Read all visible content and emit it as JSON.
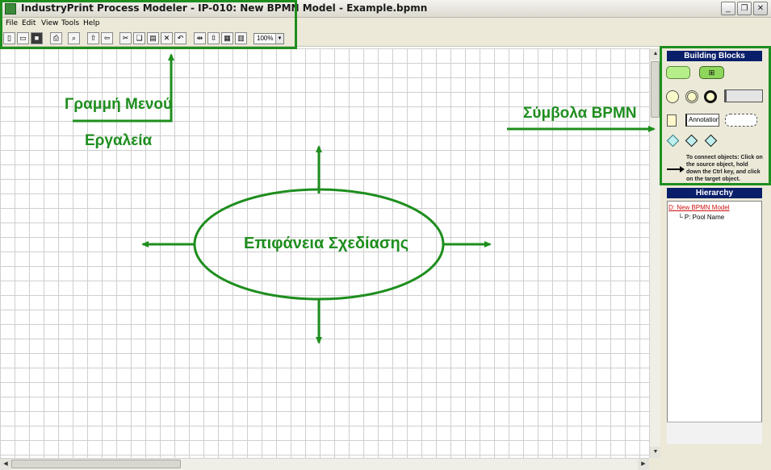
{
  "window": {
    "title": "IndustryPrint Process Modeler - IP-010: New BPMN Model - Example.bpmn",
    "controls": [
      "minimize-icon",
      "restore-icon",
      "close-icon"
    ]
  },
  "menu": [
    "File",
    "Edit",
    "View",
    "Tools",
    "Help"
  ],
  "toolbar": {
    "buttons": [
      "new-icon",
      "open-icon",
      "save-icon",
      "print-icon",
      "find-icon",
      "up-icon",
      "back-icon",
      "cut-icon",
      "copy-icon",
      "paste-icon",
      "delete-icon",
      "undo-icon",
      "align-h-icon",
      "align-v-icon",
      "distribute-icon",
      "layout-icon"
    ],
    "zoom": "100%"
  },
  "panels": {
    "building_blocks": {
      "title": "Building Blocks",
      "annotation_label": "Annotation",
      "help": "To connect objects: Click on the source object, hold down the Ctrl key, and click on the target object."
    },
    "hierarchy": {
      "title": "Hierarchy",
      "root": "D: New BPMN Model",
      "child": "P: Pool Name"
    }
  },
  "annotations": {
    "menu_line": "Γραμμή Μενού",
    "tools": "Εργαλεία",
    "bpmn_symbols": "Σύμβολα BPMN",
    "design_surface": "Επιφάνεια Σχεδίασης"
  },
  "colors": {
    "annotation_green": "#1e8e1e",
    "panel_header": "#0a1f6a",
    "task_green": "#b6ef8a"
  }
}
